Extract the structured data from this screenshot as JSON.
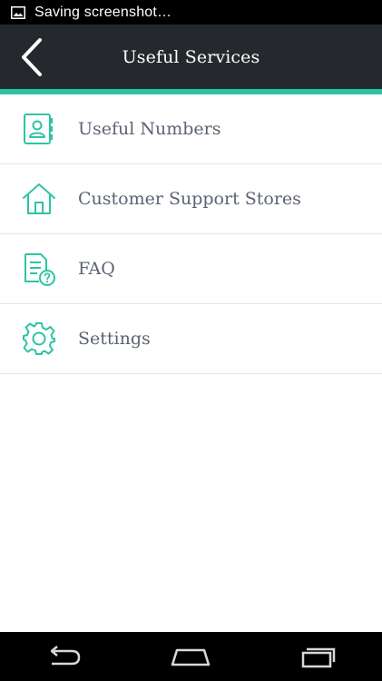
{
  "status_bar": {
    "text": "Saving screenshot…",
    "icon": "image-icon"
  },
  "app_bar": {
    "title": "Useful Services",
    "back_icon": "chevron-left-icon"
  },
  "colors": {
    "accent": "#2ec4a3",
    "app_bar_bg": "#25292d",
    "label": "#5b6373"
  },
  "menu": {
    "items": [
      {
        "label": "Useful Numbers",
        "icon": "contact-book-icon"
      },
      {
        "label": "Customer Support Stores",
        "icon": "home-icon"
      },
      {
        "label": "FAQ",
        "icon": "faq-document-icon"
      },
      {
        "label": "Settings",
        "icon": "gear-icon"
      }
    ]
  },
  "nav_bar": {
    "back_icon": "nav-back-icon",
    "home_icon": "nav-home-icon",
    "recents_icon": "nav-recents-icon"
  }
}
